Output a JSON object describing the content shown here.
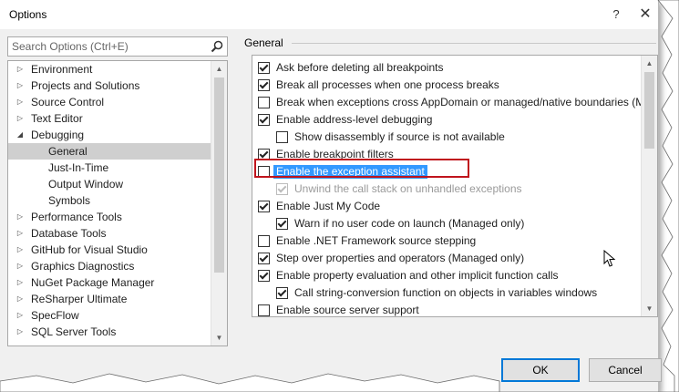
{
  "window": {
    "title": "Options",
    "help_label": "?",
    "close_label": "✕"
  },
  "search": {
    "placeholder": "Search Options (Ctrl+E)",
    "value": ""
  },
  "tree": {
    "items": [
      {
        "label": "Environment",
        "level": 0,
        "expanded": false,
        "selected": false
      },
      {
        "label": "Projects and Solutions",
        "level": 0,
        "expanded": false,
        "selected": false
      },
      {
        "label": "Source Control",
        "level": 0,
        "expanded": false,
        "selected": false
      },
      {
        "label": "Text Editor",
        "level": 0,
        "expanded": false,
        "selected": false
      },
      {
        "label": "Debugging",
        "level": 0,
        "expanded": true,
        "selected": false
      },
      {
        "label": "General",
        "level": 1,
        "selected": true
      },
      {
        "label": "Just-In-Time",
        "level": 1,
        "selected": false
      },
      {
        "label": "Output Window",
        "level": 1,
        "selected": false
      },
      {
        "label": "Symbols",
        "level": 1,
        "selected": false
      },
      {
        "label": "Performance Tools",
        "level": 0,
        "expanded": false,
        "selected": false
      },
      {
        "label": "Database Tools",
        "level": 0,
        "expanded": false,
        "selected": false
      },
      {
        "label": "GitHub for Visual Studio",
        "level": 0,
        "expanded": false,
        "selected": false
      },
      {
        "label": "Graphics Diagnostics",
        "level": 0,
        "expanded": false,
        "selected": false
      },
      {
        "label": "NuGet Package Manager",
        "level": 0,
        "expanded": false,
        "selected": false
      },
      {
        "label": "ReSharper Ultimate",
        "level": 0,
        "expanded": false,
        "selected": false
      },
      {
        "label": "SpecFlow",
        "level": 0,
        "expanded": false,
        "selected": false
      },
      {
        "label": "SQL Server Tools",
        "level": 0,
        "expanded": false,
        "selected": false
      }
    ]
  },
  "section": {
    "title": "General"
  },
  "options": [
    {
      "label": "Ask before deleting all breakpoints",
      "checked": true,
      "indent": 0,
      "disabled": false
    },
    {
      "label": "Break all processes when one process breaks",
      "checked": true,
      "indent": 0,
      "disabled": false
    },
    {
      "label": "Break when exceptions cross AppDomain or managed/native boundaries (M",
      "checked": false,
      "indent": 0,
      "disabled": false
    },
    {
      "label": "Enable address-level debugging",
      "checked": true,
      "indent": 0,
      "disabled": false
    },
    {
      "label": "Show disassembly if source is not available",
      "checked": false,
      "indent": 1,
      "disabled": false
    },
    {
      "label": "Enable breakpoint filters",
      "checked": true,
      "indent": 0,
      "disabled": false
    },
    {
      "label": "Enable the exception assistant",
      "checked": false,
      "indent": 0,
      "disabled": false,
      "highlighted": true
    },
    {
      "label": "Unwind the call stack on unhandled exceptions",
      "checked": true,
      "indent": 1,
      "disabled": true
    },
    {
      "label": "Enable Just My Code",
      "checked": true,
      "indent": 0,
      "disabled": false
    },
    {
      "label": "Warn if no user code on launch (Managed only)",
      "checked": true,
      "indent": 1,
      "disabled": false
    },
    {
      "label": "Enable .NET Framework source stepping",
      "checked": false,
      "indent": 0,
      "disabled": false
    },
    {
      "label": "Step over properties and operators (Managed only)",
      "checked": true,
      "indent": 0,
      "disabled": false
    },
    {
      "label": "Enable property evaluation and other implicit function calls",
      "checked": true,
      "indent": 0,
      "disabled": false
    },
    {
      "label": "Call string-conversion function on objects in variables windows",
      "checked": true,
      "indent": 1,
      "disabled": false
    },
    {
      "label": "Enable source server support",
      "checked": false,
      "indent": 0,
      "disabled": false
    }
  ],
  "buttons": {
    "ok": "OK",
    "cancel": "Cancel"
  },
  "colors": {
    "selection": "#3399ff",
    "callout": "#c0141d",
    "tree_selected": "#cfcfcf"
  }
}
